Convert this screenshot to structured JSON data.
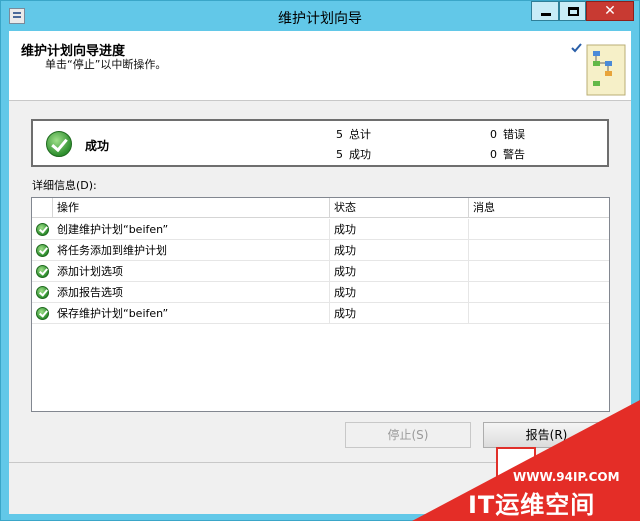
{
  "window": {
    "title": "维护计划向导",
    "close_glyph": "✕"
  },
  "header": {
    "title": "维护计划向导进度",
    "subtitle": "单击“停止”以中断操作。"
  },
  "summary": {
    "status": "成功",
    "stats": [
      {
        "count": "5",
        "label": "总计"
      },
      {
        "count": "5",
        "label": "成功"
      },
      {
        "count": "0",
        "label": "错误"
      },
      {
        "count": "0",
        "label": "警告"
      }
    ]
  },
  "details": {
    "label": "详细信息(D):",
    "columns": [
      "操作",
      "状态",
      "消息"
    ],
    "rows": [
      {
        "action": "创建维护计划“beifen”",
        "status": "成功",
        "message": ""
      },
      {
        "action": "将任务添加到维护计划",
        "status": "成功",
        "message": ""
      },
      {
        "action": "添加计划选项",
        "status": "成功",
        "message": ""
      },
      {
        "action": "添加报告选项",
        "status": "成功",
        "message": ""
      },
      {
        "action": "保存维护计划“beifen”",
        "status": "成功",
        "message": ""
      }
    ]
  },
  "buttons": {
    "stop": "停止(S)",
    "report": "报告(R)"
  },
  "watermark": {
    "url": "WWW.94IP.COM",
    "brand": "IT运维空间"
  },
  "icons": {
    "success": "success-check-icon",
    "app": "app-icon",
    "wizard": "wizard-graphic-icon"
  }
}
